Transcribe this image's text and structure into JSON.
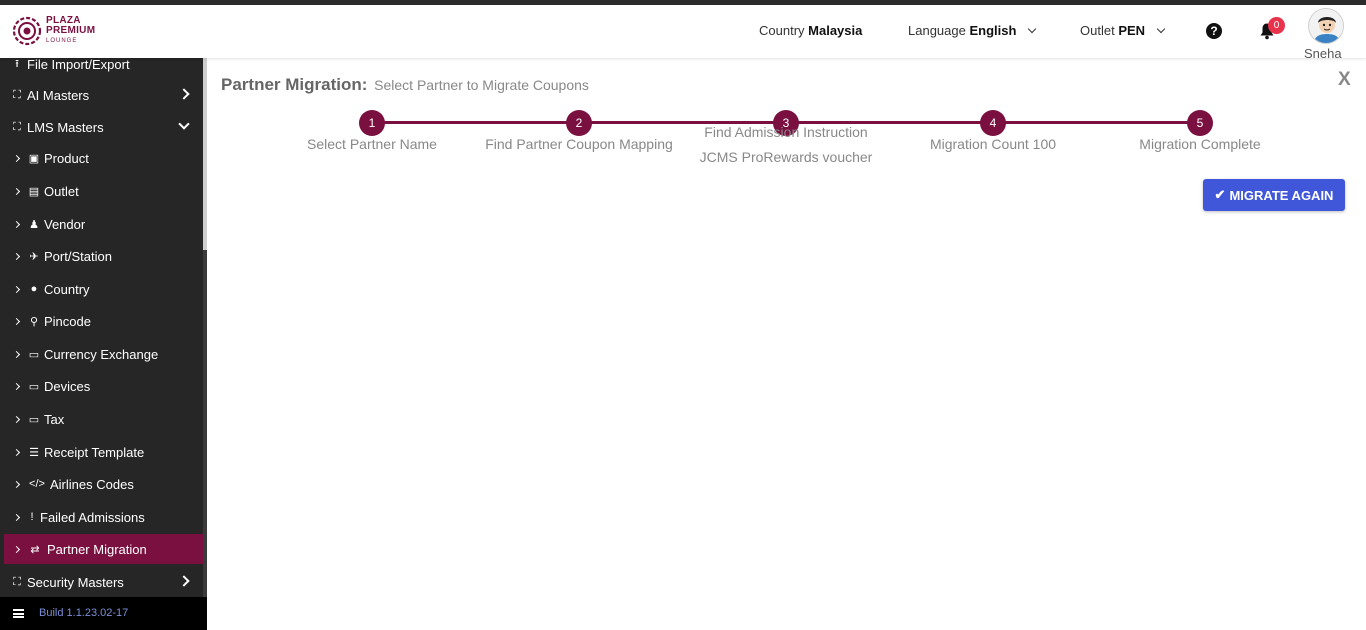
{
  "brand": {
    "line1": "PLAZA",
    "line2": "PREMIUM",
    "line3": "LOUNGE",
    "color": "#7a1040"
  },
  "header": {
    "country_label": "Country",
    "country_value": "Malaysia",
    "language_label": "Language",
    "language_value": "English",
    "outlet_label": "Outlet",
    "outlet_value": "PEN",
    "help_icon": "?",
    "notification_count": "0",
    "username": "Sneha"
  },
  "sidebar": {
    "items": [
      {
        "label": "File Import/Export",
        "icon": "upload-icon"
      },
      {
        "label": "AI Masters",
        "icon": "sitemap-icon"
      },
      {
        "label": "LMS Masters",
        "icon": "sitemap-icon"
      },
      {
        "label": "Product",
        "icon": "gift-icon"
      },
      {
        "label": "Outlet",
        "icon": "building-icon"
      },
      {
        "label": "Vendor",
        "icon": "person-icon"
      },
      {
        "label": "Port/Station",
        "icon": "plane-icon"
      },
      {
        "label": "Country",
        "icon": "globe-icon"
      },
      {
        "label": "Pincode",
        "icon": "map-marker-icon"
      },
      {
        "label": "Currency Exchange",
        "icon": "money-icon"
      },
      {
        "label": "Devices",
        "icon": "laptop-icon"
      },
      {
        "label": "Tax",
        "icon": "money-icon"
      },
      {
        "label": "Receipt Template",
        "icon": "list-alt-icon"
      },
      {
        "label": "Airlines Codes",
        "icon": "code-icon"
      },
      {
        "label": "Failed Admissions",
        "icon": "exclamation-icon"
      },
      {
        "label": "Partner Migration",
        "icon": "exchange-icon"
      },
      {
        "label": "Security Masters",
        "icon": "sitemap-icon"
      }
    ],
    "build": "Build 1.1.23.02-17"
  },
  "page": {
    "title": "Partner Migration:",
    "subtitle": "Select Partner to Migrate Coupons",
    "close": "X",
    "steps": [
      {
        "number": "1",
        "label": "Select Partner Name",
        "sublabel": ""
      },
      {
        "number": "2",
        "label": "Find Partner Coupon Mapping",
        "sublabel": ""
      },
      {
        "number": "3",
        "label": "Find Admission Instruction",
        "sublabel": "JCMS ProRewards voucher"
      },
      {
        "number": "4",
        "label": "Migration Count 100",
        "sublabel": ""
      },
      {
        "number": "5",
        "label": "Migration Complete",
        "sublabel": ""
      }
    ],
    "migrate_button": "MIGRATE AGAIN"
  },
  "colors": {
    "accent": "#7a1040",
    "button": "#3f57d8",
    "sidebar_bg": "#262626"
  }
}
